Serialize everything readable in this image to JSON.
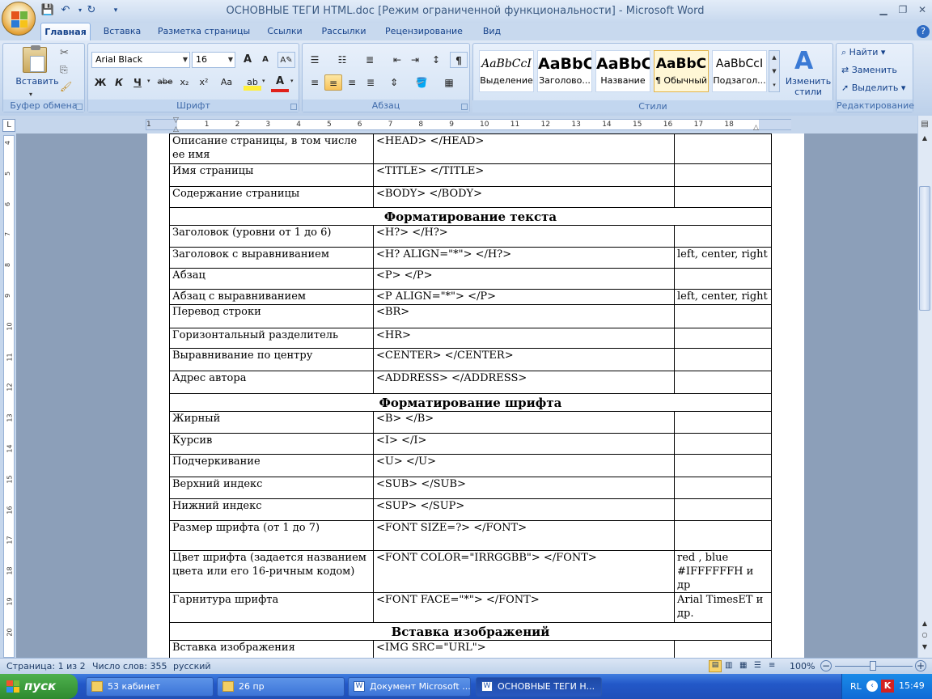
{
  "titlebar": {
    "title": "ОСНОВНЫЕ   ТЕГИ  HTML.doc [Режим ограниченной функциональности] - Microsoft Word"
  },
  "tabs": [
    "Главная",
    "Вставка",
    "Разметка страницы",
    "Ссылки",
    "Рассылки",
    "Рецензирование",
    "Вид"
  ],
  "ribbon": {
    "clipboard": {
      "paste": "Вставить",
      "label": "Буфер обмена"
    },
    "font": {
      "name": "Arial Black",
      "size": "16",
      "bold": "Ж",
      "italic": "К",
      "underline": "Ч",
      "strike": "abe",
      "sub": "x₂",
      "sup": "x²",
      "case": "Aa",
      "grow": "A",
      "shrink": "A",
      "label": "Шрифт"
    },
    "paragraph": {
      "label": "Абзац"
    },
    "styles": {
      "items": [
        {
          "sample": "AaBbCcI",
          "name": "Выделение"
        },
        {
          "sample": "AaBbC",
          "name": "Заголово..."
        },
        {
          "sample": "AaBbC",
          "name": "Название"
        },
        {
          "sample": "AaBbC",
          "name": "¶ Обычный"
        },
        {
          "sample": "AaBbCcI",
          "name": "Подзагол..."
        }
      ],
      "change": "Изменить стили",
      "label": "Стили"
    },
    "editing": {
      "find": "Найти",
      "replace": "Заменить",
      "select": "Выделить",
      "label": "Редактирование"
    }
  },
  "table": {
    "rows": [
      {
        "c1": "Описание страницы, в том числе ее имя",
        "c2": "<HEAD> </HEAD>",
        "c3": ""
      },
      {
        "c1": "Имя страницы",
        "c2": "<TITLE> </TITLE>",
        "c3": ""
      },
      {
        "c1": "Содержание страницы",
        "c2": "<BODY> </BODY>",
        "c3": ""
      },
      {
        "header": "Форматирование текста"
      },
      {
        "c1": "Заголовок (уровни от 1 до 6)",
        "c2": "<H?> </H?>",
        "c3": ""
      },
      {
        "c1": "Заголовок с выравниванием",
        "c2": "<H? ALIGN=\"*\"> </H?>",
        "c3": "left, center, right"
      },
      {
        "c1": "Абзац",
        "c2": "<P> </P>",
        "c3": ""
      },
      {
        "c1": "Абзац с выравниванием",
        "c2": "<P ALIGN=\"*\"> </P>",
        "c3": "left, center, right"
      },
      {
        "c1": "Перевод строки",
        "c2": "<BR>",
        "c3": ""
      },
      {
        "c1": "Горизонтальный разделитель",
        "c2": "<HR>",
        "c3": ""
      },
      {
        "c1": "Выравнивание по центру",
        "c2": "<CENTER> </CENTER>",
        "c3": ""
      },
      {
        "c1": "Адрес автора",
        "c2": "<ADDRESS> </ADDRESS>",
        "c3": ""
      },
      {
        "header": "Форматирование шрифта"
      },
      {
        "c1": "Жирный",
        "c2": "<B> </B>",
        "c3": ""
      },
      {
        "c1": "Курсив",
        "c2": "<I> </I>",
        "c3": ""
      },
      {
        "c1": "Подчеркивание",
        "c2": "<U> </U>",
        "c3": ""
      },
      {
        "c1": "Верхний индекс",
        "c2": "<SUB> </SUB>",
        "c3": ""
      },
      {
        "c1": "Нижний индекс",
        "c2": "<SUP> </SUP>",
        "c3": ""
      },
      {
        "c1": "Размер шрифта (от 1 до 7)",
        "c2": "<FONT SIZE=?> </FONT>",
        "c3": ""
      },
      {
        "c1": "Цвет шрифта (задается названием цвета или его 16-ричным кодом)",
        "c2": "<FONT COLOR=\"IRRGGBB\"> </FONT>",
        "c3": "red , blue #IFFFFFFH и др"
      },
      {
        "c1": "Гарнитура шрифта",
        "c2": "<FONT FACE=\"*\"> </FONT>",
        "c3": "Arial TimesET  и др."
      },
      {
        "header": "Вставка изображений"
      },
      {
        "c1": "Вставка изображения",
        "c2": "<IMG SRC=\"URL\">",
        "c3": ""
      }
    ]
  },
  "status": {
    "page": "Страница: 1 из 2",
    "words": "Число слов: 355",
    "lang": "русский",
    "zoom": "100%"
  },
  "taskbar": {
    "start": "пуск",
    "tasks": [
      "53 кабинет",
      "26 пр",
      "Документ Microsoft ...",
      "ОСНОВНЫЕ   ТЕГИ  Н..."
    ],
    "lang": "RL",
    "time": "15:49"
  },
  "hruler_ticks": [
    "1",
    "1",
    "2",
    "3",
    "4",
    "5",
    "6",
    "7",
    "8",
    "9",
    "10",
    "11",
    "12",
    "13",
    "14",
    "15",
    "16",
    "17",
    "18"
  ],
  "vruler_ticks": [
    "4",
    "5",
    "6",
    "7",
    "8",
    "9",
    "10",
    "11",
    "12",
    "13",
    "14",
    "15",
    "16",
    "17",
    "18",
    "19",
    "20"
  ]
}
